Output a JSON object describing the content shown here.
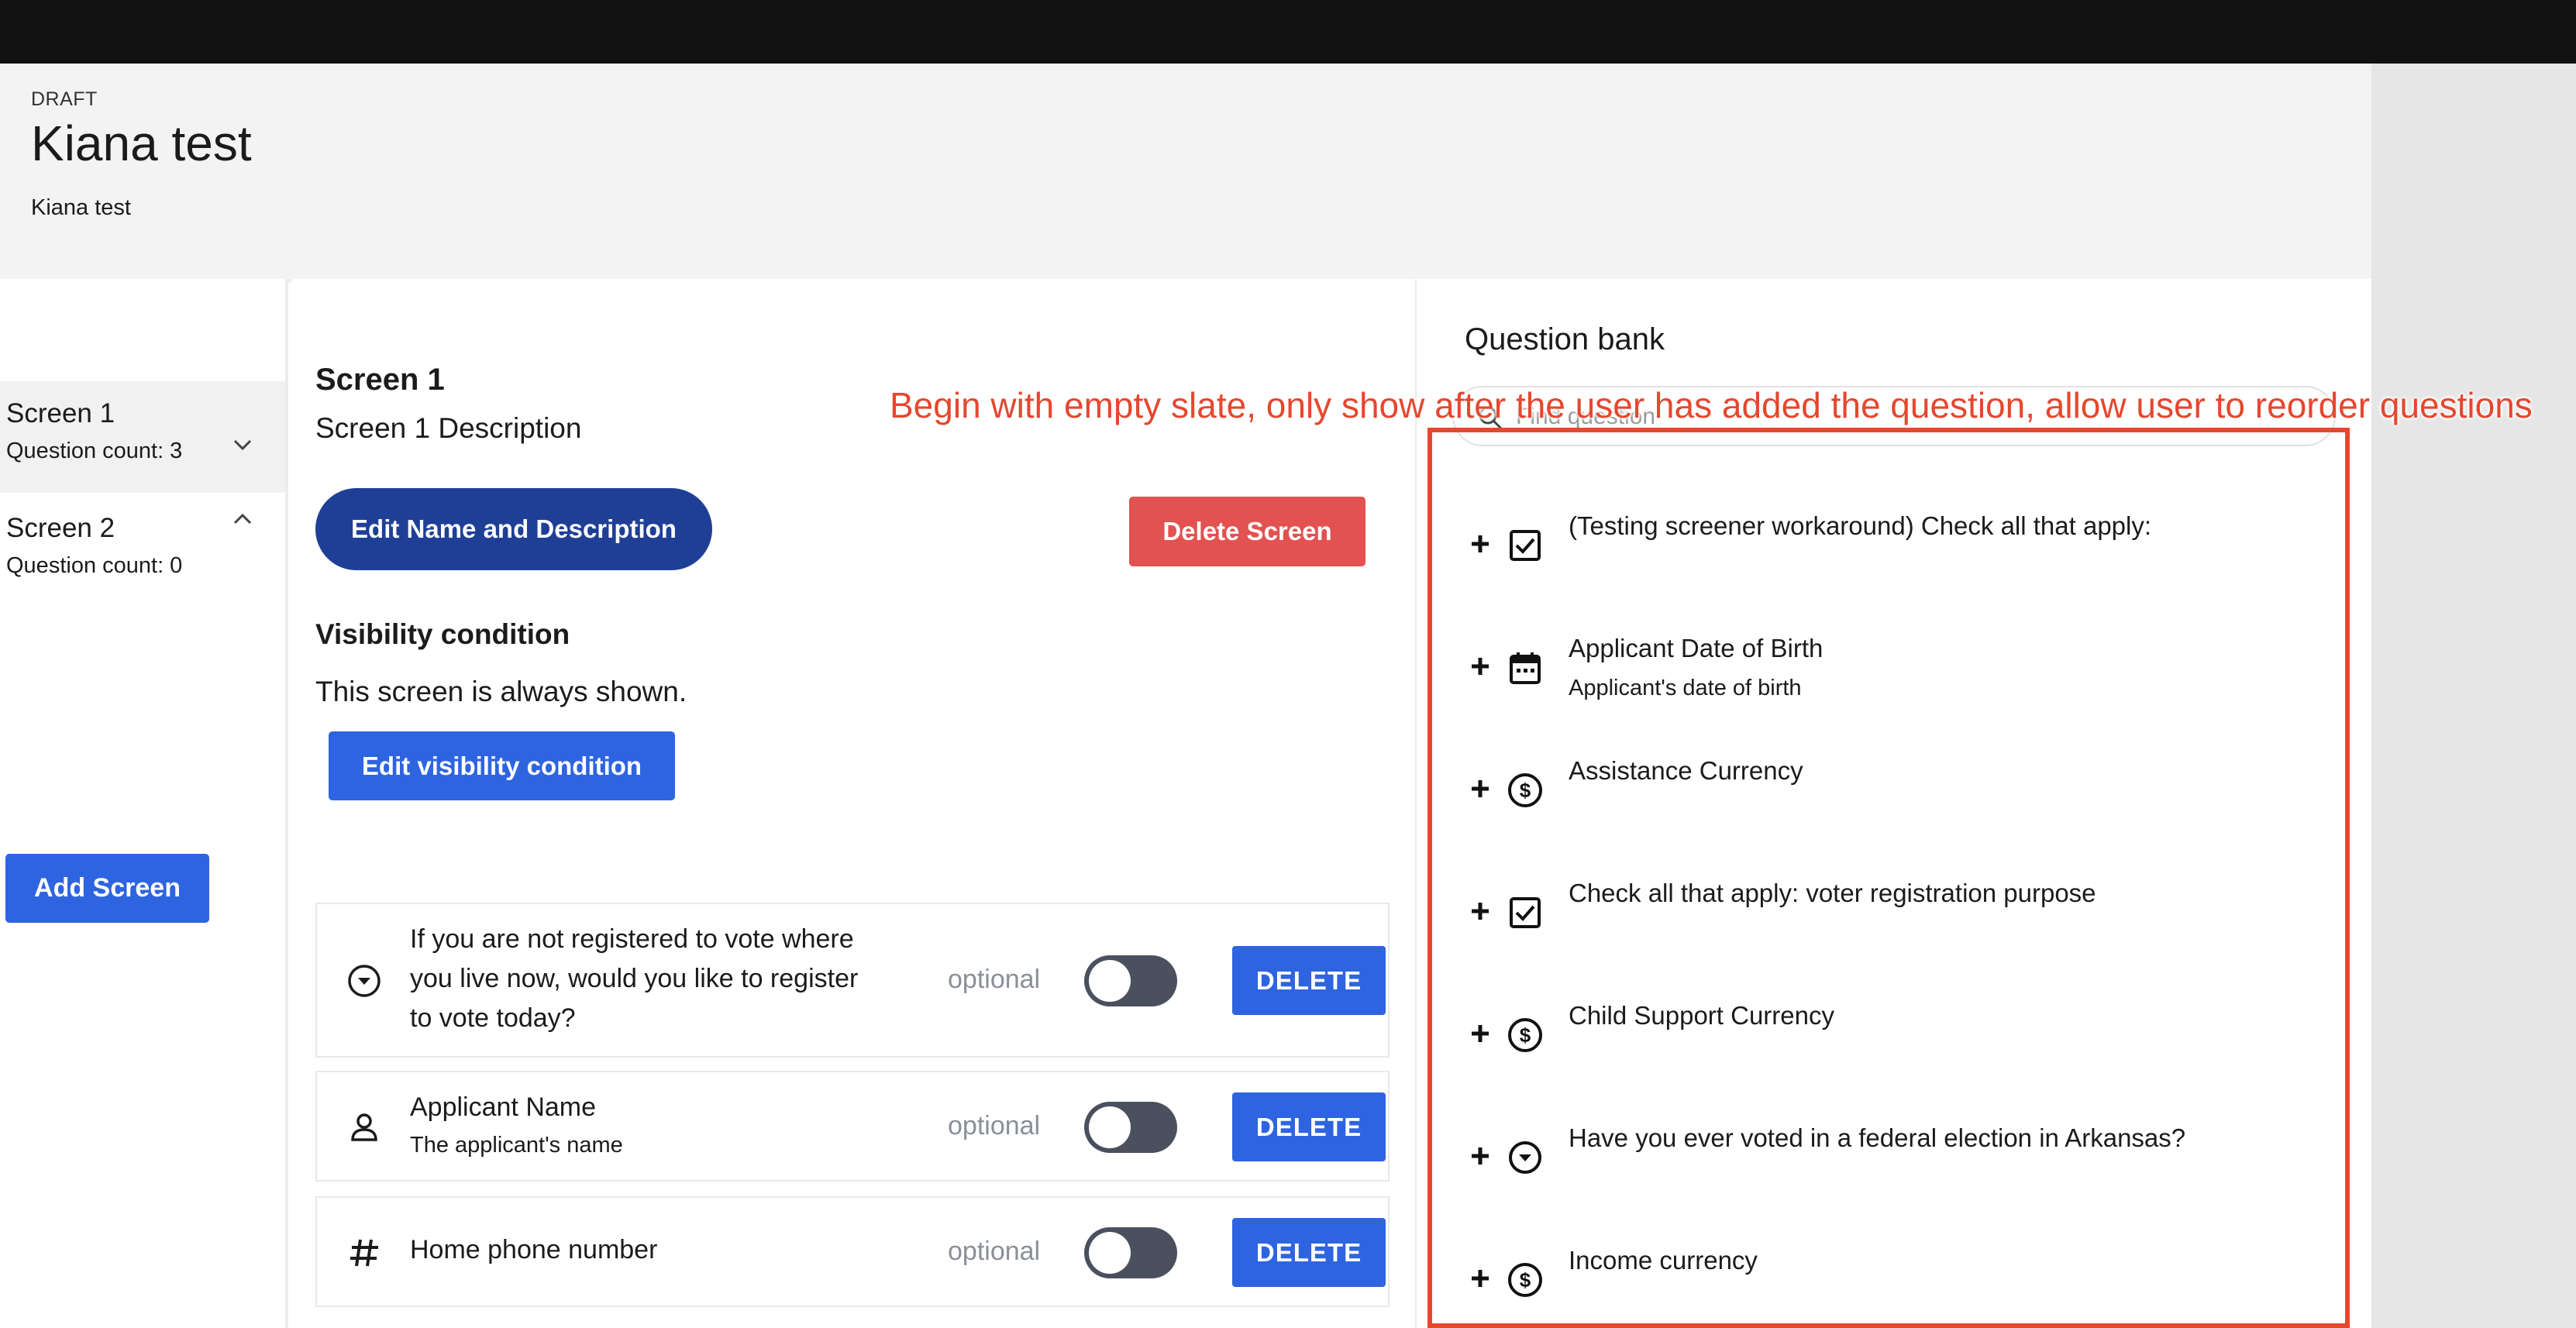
{
  "header": {
    "status": "DRAFT",
    "title": "Kiana test",
    "description": "Kiana test"
  },
  "sidebar": {
    "screens": [
      {
        "name": "Screen 1",
        "count": "Question count: 3",
        "expanded": false
      },
      {
        "name": "Screen 2",
        "count": "Question count: 0",
        "expanded": true
      }
    ],
    "add_label": "Add Screen"
  },
  "center": {
    "screen_title": "Screen 1",
    "screen_description": "Screen 1 Description",
    "edit_name_label": "Edit Name and Description",
    "delete_screen_label": "Delete Screen",
    "visibility_title": "Visibility condition",
    "visibility_text": "This screen is always shown.",
    "edit_visibility_label": "Edit visibility condition",
    "questions": [
      {
        "icon": "dropdown-circle-icon",
        "title_lines": [
          "If you are not registered to vote where",
          "you live now, would you like to register",
          "to vote today?"
        ],
        "optional": "optional",
        "delete": "DELETE"
      },
      {
        "icon": "person-icon",
        "title": "Applicant Name",
        "subtitle": "The applicant's name",
        "optional": "optional",
        "delete": "DELETE"
      },
      {
        "icon": "hash-icon",
        "title": "Home phone number",
        "optional": "optional",
        "delete": "DELETE"
      }
    ]
  },
  "bank": {
    "title": "Question bank",
    "search_placeholder": "Find question",
    "items": [
      {
        "icon": "checkbox-icon",
        "title": "(Testing screener workaround) Check all that apply:"
      },
      {
        "icon": "calendar-icon",
        "title": "Applicant Date of Birth",
        "subtitle": "Applicant's date of birth"
      },
      {
        "icon": "dollar-icon",
        "title": "Assistance Currency"
      },
      {
        "icon": "checkbox-icon",
        "title": "Check all that apply: voter registration purpose"
      },
      {
        "icon": "dollar-icon",
        "title": "Child Support Currency"
      },
      {
        "icon": "dropdown-circle-icon",
        "title": "Have you ever voted in a federal election in Arkansas?"
      },
      {
        "icon": "dollar-icon",
        "title": "Income currency"
      }
    ]
  },
  "annotation": "Begin with empty slate, only show after the user has added the question, allow user to reorder questions",
  "colors": {
    "primary": "#2e64e0",
    "dark_primary": "#1f3f97",
    "danger": "#e25250",
    "annotation": "#e5472f"
  }
}
